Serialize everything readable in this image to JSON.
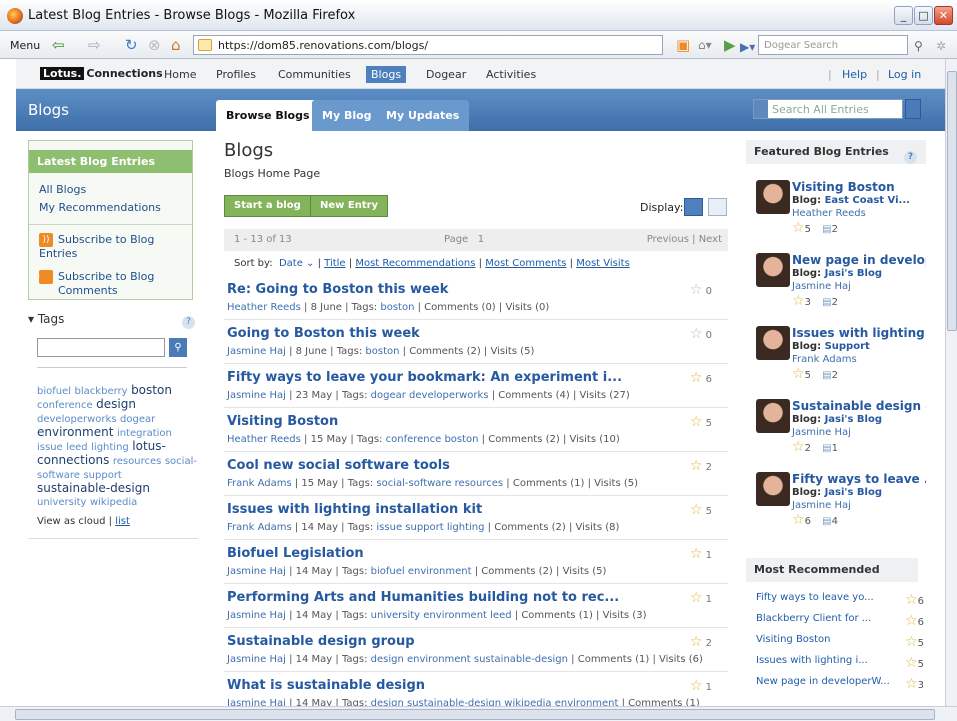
{
  "window": {
    "title": "Latest Blog Entries - Browse Blogs - Mozilla Firefox"
  },
  "browser": {
    "menu": "Menu",
    "url": "https://dom85.renovations.com/blogs/",
    "search_placeholder": "Dogear Search"
  },
  "topnav": {
    "logo_box": "Lotus.",
    "logo_text": "Connections",
    "items": [
      "Home",
      "Profiles",
      "Communities",
      "Blogs",
      "Dogear",
      "Activities"
    ],
    "help": "Help",
    "login": "Log in"
  },
  "banner": {
    "title": "Blogs",
    "tabs": [
      "Browse Blogs",
      "My Blog",
      "My Updates"
    ],
    "search_placeholder": "Search All Entries"
  },
  "left": {
    "panel_header": "Latest Blog Entries",
    "links": [
      "All Blogs",
      "My Recommendations"
    ],
    "subscribe": [
      "Subscribe to Blog Entries",
      "Subscribe to Blog Comments"
    ],
    "tags_title": "▾ Tags",
    "tags": [
      {
        "t": "biofuel",
        "b": false
      },
      {
        "t": "blackberry",
        "b": false
      },
      {
        "t": "boston",
        "b": true
      },
      {
        "t": "conference",
        "b": false
      },
      {
        "t": "design",
        "b": true
      },
      {
        "t": "developerworks",
        "b": false
      },
      {
        "t": "dogear",
        "b": false
      },
      {
        "t": "environment",
        "b": true
      },
      {
        "t": "integration",
        "b": false
      },
      {
        "t": "issue",
        "b": false
      },
      {
        "t": "leed",
        "b": false
      },
      {
        "t": "lighting",
        "b": false
      },
      {
        "t": "lotus-connections",
        "b": true
      },
      {
        "t": "resources",
        "b": false
      },
      {
        "t": "social-software",
        "b": false
      },
      {
        "t": "support",
        "b": false
      },
      {
        "t": "sustainable-design",
        "b": true
      },
      {
        "t": "university",
        "b": false
      },
      {
        "t": "wikipedia",
        "b": false
      }
    ],
    "view_as": "View as cloud | ",
    "list": "list"
  },
  "main": {
    "title": "Blogs",
    "subtitle": "Blogs Home Page",
    "start_blog": "Start a blog",
    "new_entry": "New Entry",
    "display": "Display:",
    "range": "1 - 13 of 13",
    "page_label": "Page",
    "page_num": "1",
    "prevnext": "Previous | Next",
    "sort_label": "Sort by:",
    "sort_items": [
      "Date ⌄",
      "Title",
      "Most Recommendations",
      "Most Comments",
      "Most Visits"
    ],
    "entries": [
      {
        "title": "Re: Going to Boston this week",
        "author": "Heather Reeds",
        "date": "8 June",
        "tags": "boston",
        "comments": "Comments (0)",
        "visits": "Visits (0)",
        "stars": "0",
        "rated": false
      },
      {
        "title": "Going to Boston this week",
        "author": "Jasmine Haj",
        "date": "8 June",
        "tags": "boston",
        "comments": "Comments (2)",
        "visits": "Visits (5)",
        "stars": "0",
        "rated": false
      },
      {
        "title": "Fifty ways to leave your bookmark: An experiment i...",
        "author": "Jasmine Haj",
        "date": "23 May",
        "tags": "dogear developerworks",
        "comments": "Comments (4)",
        "visits": "Visits (27)",
        "stars": "6",
        "rated": true
      },
      {
        "title": "Visiting Boston",
        "author": "Heather Reeds",
        "date": "15 May",
        "tags": "conference boston",
        "comments": "Comments (2)",
        "visits": "Visits (10)",
        "stars": "5",
        "rated": true
      },
      {
        "title": "Cool new social software tools",
        "author": "Frank Adams",
        "date": "15 May",
        "tags": "social-software resources",
        "comments": "Comments (1)",
        "visits": "Visits (5)",
        "stars": "2",
        "rated": true
      },
      {
        "title": "Issues with lighting installation kit",
        "author": "Frank Adams",
        "date": "14 May",
        "tags": "issue support lighting",
        "comments": "Comments (2)",
        "visits": "Visits (8)",
        "stars": "5",
        "rated": true
      },
      {
        "title": "Biofuel Legislation",
        "author": "Jasmine Haj",
        "date": "14 May",
        "tags": "biofuel environment",
        "comments": "Comments (2)",
        "visits": "Visits (5)",
        "stars": "1",
        "rated": true
      },
      {
        "title": "Performing Arts and Humanities building not to rec...",
        "author": "Jasmine Haj",
        "date": "14 May",
        "tags": "university environment leed",
        "comments": "Comments (1)",
        "visits": "Visits (3)",
        "stars": "1",
        "rated": true
      },
      {
        "title": "Sustainable design group",
        "author": "Jasmine Haj",
        "date": "14 May",
        "tags": "design environment sustainable-design",
        "comments": "Comments (1)",
        "visits": "Visits (6)",
        "stars": "2",
        "rated": true
      },
      {
        "title": "What is sustainable design",
        "author": "Jasmine Haj",
        "date": "14 May",
        "tags": "design sustainable-design wikipedia environment",
        "comments": "Comments (1)",
        "visits": "",
        "stars": "1",
        "rated": true
      }
    ]
  },
  "right": {
    "featured_title": "Featured Blog Entries",
    "featured": [
      {
        "title": "Visiting Boston",
        "blog_label": "Blog:",
        "blog": "East Coast Vi...",
        "author": "Heather Reeds",
        "stars": "5",
        "comments": "2"
      },
      {
        "title": "New page in develope",
        "blog_label": "Blog:",
        "blog": "Jasi's Blog",
        "author": "Jasmine Haj",
        "stars": "3",
        "comments": "2"
      },
      {
        "title": "Issues with lighting...",
        "blog_label": "Blog:",
        "blog": "Support",
        "author": "Frank Adams",
        "stars": "5",
        "comments": "2"
      },
      {
        "title": "Sustainable design g..",
        "blog_label": "Blog:",
        "blog": "Jasi's Blog",
        "author": "Jasmine Haj",
        "stars": "2",
        "comments": "1"
      },
      {
        "title": "Fifty ways to leave ...",
        "blog_label": "Blog:",
        "blog": "Jasi's Blog",
        "author": "Jasmine Haj",
        "stars": "6",
        "comments": "4"
      }
    ],
    "recommended_title": "Most Recommended",
    "recommended": [
      {
        "title": "Fifty ways to leave yo...",
        "stars": "6"
      },
      {
        "title": "Blackberry Client for ...",
        "stars": "6"
      },
      {
        "title": "Visiting Boston",
        "stars": "5"
      },
      {
        "title": "Issues with lighting i...",
        "stars": "5"
      },
      {
        "title": "New page in developerW...",
        "stars": "3"
      }
    ]
  }
}
